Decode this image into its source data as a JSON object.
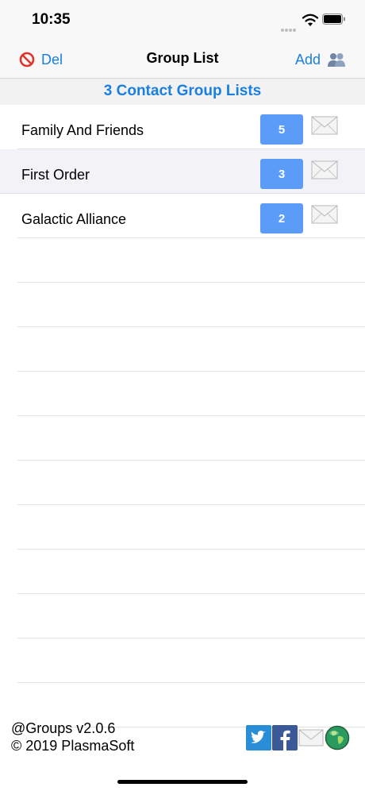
{
  "status": {
    "time": "10:35"
  },
  "nav": {
    "del_label": "Del",
    "title": "Group List",
    "add_label": "Add"
  },
  "header": {
    "title": "3 Contact Group Lists"
  },
  "groups": [
    {
      "name": "Family And Friends",
      "count": "5"
    },
    {
      "name": "First Order",
      "count": "3"
    },
    {
      "name": "Galactic Alliance",
      "count": "2"
    }
  ],
  "footer": {
    "version": "@Groups v2.0.6",
    "copyright": "© 2019 PlasmaSoft"
  },
  "colors": {
    "accent": "#1a7fe0",
    "badge": "#5b9cf9",
    "twitter": "#2a8ed6",
    "facebook": "#3b5998"
  },
  "icons": {
    "del": "prohibited-icon",
    "add": "people-icon",
    "mail": "envelope-icon",
    "social": [
      "twitter-icon",
      "facebook-icon",
      "envelope-icon",
      "globe-icon"
    ]
  }
}
